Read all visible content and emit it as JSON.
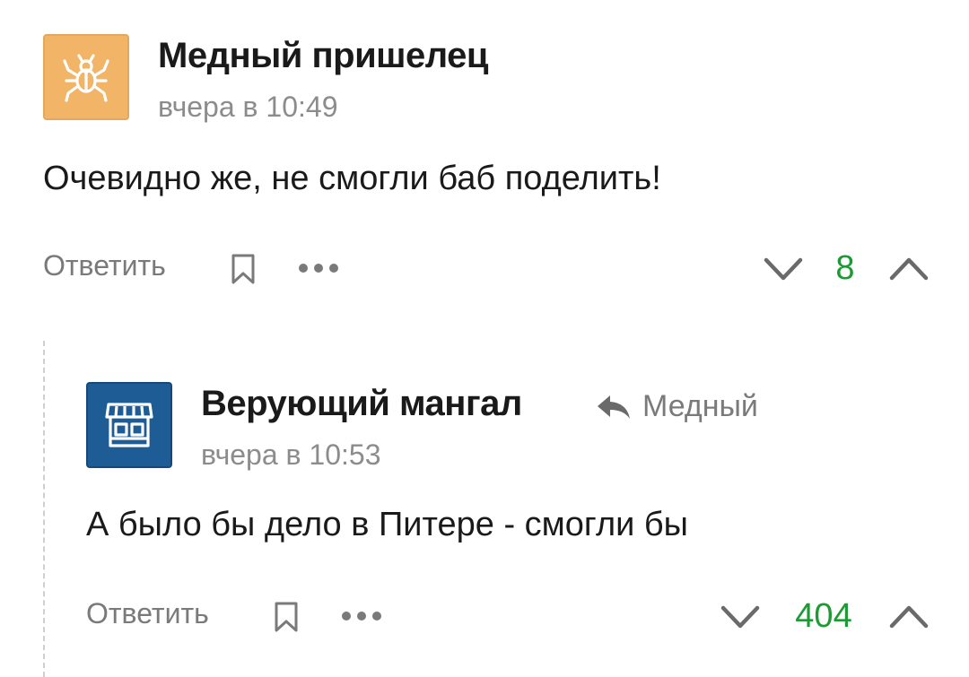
{
  "comments": [
    {
      "author": "Медный пришелец",
      "time": "вчера в 10:49",
      "text": "Очевидно же, не смогли баб поделить!",
      "reply_label": "Ответить",
      "score": "8",
      "avatar_icon": "bug-icon",
      "avatar_color": "#f2b466"
    },
    {
      "author": "Верующий мангал",
      "time": "вчера в 10:53",
      "reply_to": "Медный",
      "text": "А было бы дело в Питере - смогли бы",
      "reply_label": "Ответить",
      "score": "404",
      "avatar_icon": "shop-icon",
      "avatar_color": "#1e5c96"
    }
  ],
  "colors": {
    "score_positive": "#1d9a34",
    "muted_text": "#8c8c8c"
  }
}
